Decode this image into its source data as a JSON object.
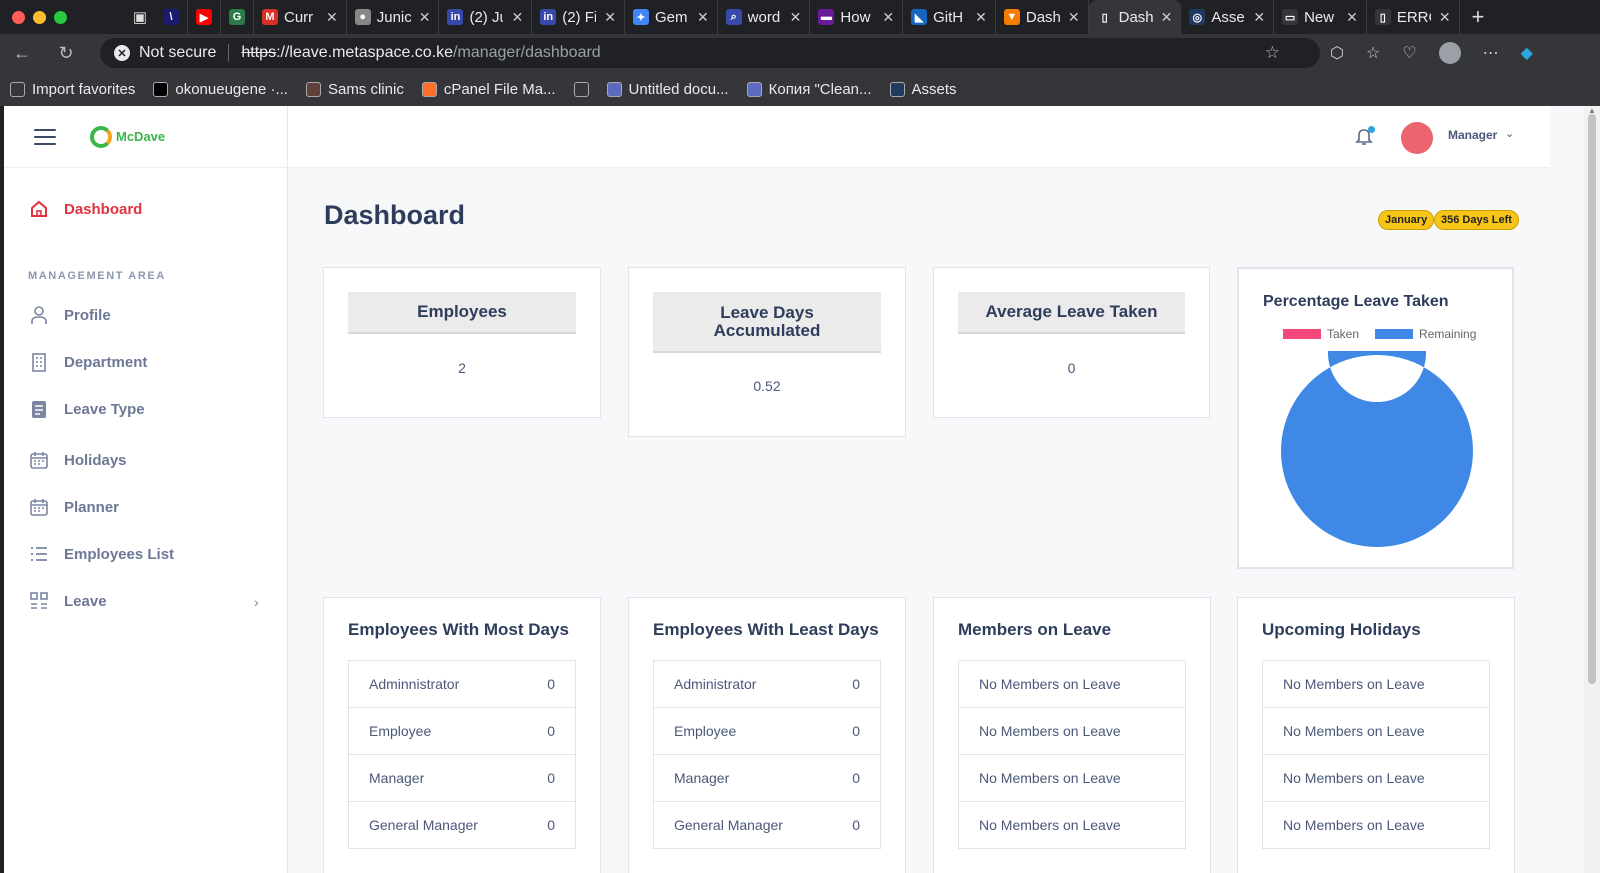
{
  "browser": {
    "tabs": [
      {
        "label": "",
        "color": "#1a1a6e",
        "glyph": "\\"
      },
      {
        "label": "",
        "color": "#ff0000",
        "glyph": "▶"
      },
      {
        "label": "",
        "color": "#2a7a4a",
        "glyph": "G"
      },
      {
        "label": "Curr",
        "color": "#d93025",
        "glyph": "M"
      },
      {
        "label": "Junic",
        "color": "#888888",
        "glyph": "●"
      },
      {
        "label": "(2) Ju",
        "color": "#3949ab",
        "glyph": "in"
      },
      {
        "label": "(2) Fi",
        "color": "#3949ab",
        "glyph": "in"
      },
      {
        "label": "Gem",
        "color": "#4285f4",
        "glyph": "✦"
      },
      {
        "label": "word",
        "color": "#3949ab",
        "glyph": "⌕"
      },
      {
        "label": "How",
        "color": "#6a1b9a",
        "glyph": "▬"
      },
      {
        "label": "GitH",
        "color": "#1565c0",
        "glyph": "◣"
      },
      {
        "label": "Dash",
        "color": "#f57c00",
        "glyph": "▼"
      },
      {
        "label": "Dash",
        "color": "#35363a",
        "glyph": "▯"
      },
      {
        "label": "Asse",
        "color": "#1e3a5f",
        "glyph": "◎"
      },
      {
        "label": "New",
        "color": "#35363a",
        "glyph": "▭"
      },
      {
        "label": "ERRC",
        "color": "#35363a",
        "glyph": "▯"
      }
    ],
    "not_secure": "Not secure",
    "url_scheme": "https",
    "url_host": "://leave.metaspace.co.ke",
    "url_path": "/manager/dashboard",
    "bookmarks": [
      {
        "label": "Import favorites",
        "color": "#35363a"
      },
      {
        "label": "okonueugene ·...",
        "color": "#000000"
      },
      {
        "label": "Sams clinic",
        "color": "#5d4037"
      },
      {
        "label": "cPanel File Ma...",
        "color": "#ff6c2c"
      },
      {
        "label": "",
        "color": "#35363a"
      },
      {
        "label": "Untitled docu...",
        "color": "#5c6bc0"
      },
      {
        "label": "Копия \"Clean...",
        "color": "#5c6bc0"
      },
      {
        "label": "Assets",
        "color": "#1e3a5f"
      }
    ]
  },
  "app": {
    "brand": "McDave",
    "user": "Manager",
    "sidebar": {
      "dashboard": "Dashboard",
      "section": "MANAGEMENT AREA",
      "items": [
        "Profile",
        "Department",
        "Leave Type",
        "Holidays",
        "Planner",
        "Employees List",
        "Leave"
      ]
    },
    "page_title": "Dashboard",
    "badges": [
      "January",
      "356 Days Left"
    ],
    "stats": [
      {
        "title": "Employees",
        "value": "2"
      },
      {
        "title": "Leave Days Accumulated",
        "value": "0.52"
      },
      {
        "title": "Average Leave Taken",
        "value": "0"
      }
    ],
    "chart_data": {
      "type": "pie",
      "title": "Percentage Leave Taken",
      "labels": [
        "Taken",
        "Remaining"
      ],
      "values": [
        0,
        100
      ],
      "colors": [
        "#f5487a",
        "#3f88e6"
      ]
    },
    "lists": [
      {
        "title": "Employees With Most Days",
        "rows": [
          [
            "Adminnistrator",
            "0"
          ],
          [
            "Employee",
            "0"
          ],
          [
            "Manager",
            "0"
          ],
          [
            "General Manager",
            "0"
          ]
        ]
      },
      {
        "title": "Employees With Least Days",
        "rows": [
          [
            "Administrator",
            "0"
          ],
          [
            "Employee",
            "0"
          ],
          [
            "Manager",
            "0"
          ],
          [
            "General Manager",
            "0"
          ]
        ]
      },
      {
        "title": "Members on Leave",
        "rows": [
          [
            "No Members on Leave",
            ""
          ],
          [
            "No Members on Leave",
            ""
          ],
          [
            "No Members on Leave",
            ""
          ],
          [
            "No Members on Leave",
            ""
          ]
        ]
      },
      {
        "title": "Upcoming Holidays",
        "rows": [
          [
            "No Members on Leave",
            ""
          ],
          [
            "No Members on Leave",
            ""
          ],
          [
            "No Members on Leave",
            ""
          ],
          [
            "No Members on Leave",
            ""
          ]
        ]
      }
    ]
  }
}
